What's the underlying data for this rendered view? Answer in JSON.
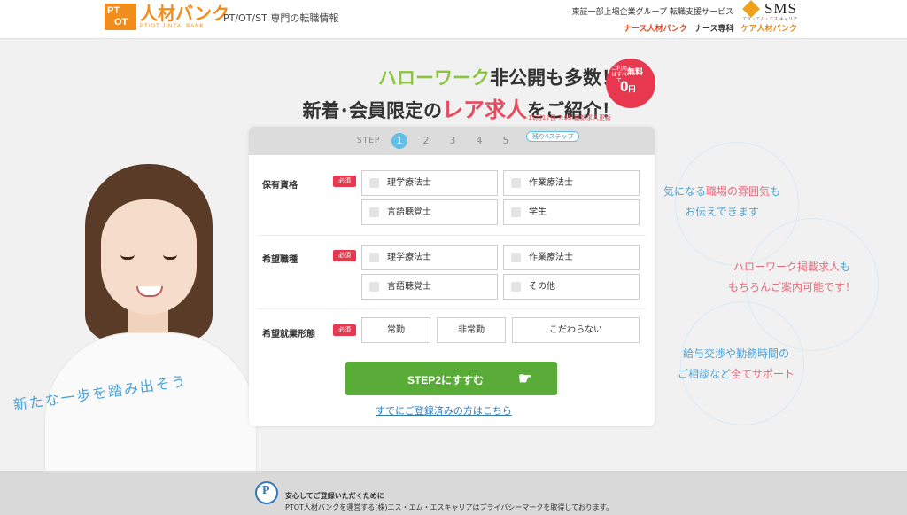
{
  "header": {
    "logo_badge_top": "PT",
    "logo_badge_bottom": "OT",
    "logo_main": "人材バンク",
    "logo_sub": "PT/OT JINZAI BANK",
    "tagline": "PT/OT/ST 専門の転職情報",
    "corp_line": "東証一部上場企業グループ 転職支援サービス",
    "sms_name": "SMS",
    "sms_sub": "エス・エム・エス キャリア",
    "brands": [
      "ナース人材バンク",
      "ナース専科",
      "ケア人材バンク"
    ]
  },
  "headline": {
    "line1_green": "ハローワーク",
    "line1_rest": "非公開も多数！",
    "line2_pre": "新着･会員限定の",
    "line2_red": "レア求人",
    "line2_post": "をご紹介！",
    "update": "11月17日 7:55 最新求人更新"
  },
  "badge": {
    "small": "ご利用はすべて",
    "label": "無料",
    "price": "0",
    "unit": "円"
  },
  "tagline": "新たな一歩を踏み出そう",
  "form": {
    "step_label": "STEP",
    "steps": [
      "1",
      "2",
      "3",
      "4",
      "5"
    ],
    "remaining": "残り4ステップ",
    "required": "必須",
    "qualification": {
      "label": "保有資格",
      "options": [
        "理学療法士",
        "作業療法士",
        "言語聴覚士",
        "学生"
      ]
    },
    "job": {
      "label": "希望職種",
      "options": [
        "理学療法士",
        "作業療法士",
        "言語聴覚士",
        "その他"
      ]
    },
    "employment": {
      "label": "希望就業形態",
      "options": [
        "常勤",
        "非常勤",
        "こだわらない"
      ]
    },
    "next_button": "STEP2にすすむ",
    "login_link": "すでにご登録済みの方はこちら"
  },
  "features": [
    {
      "line1_a": "気になる",
      "line1_b": "職場の雰囲気",
      "line1_c": "も",
      "line2": "お伝えできます"
    },
    {
      "line1_a": "ハローワーク掲載求人",
      "line1_b": "も",
      "line2": "もちろんご案内可能です！"
    },
    {
      "line1_a": "給与交渉や勤務時間の",
      "line2_a": "ご相談など",
      "line2_b": "全てサポート"
    }
  ],
  "footer": {
    "pmark": "P",
    "title": "安心してご登録いただくために",
    "text": "PTOT人材バンクを運営する(株)エス・エム・エスキャリアはプライバシーマークを取得しております。"
  },
  "colors": {
    "brand_orange": "#f28c1b",
    "green_button": "#5aac38",
    "accent_red": "#e8384f",
    "accent_blue": "#64bfe6",
    "accent_green": "#8cc63f"
  }
}
